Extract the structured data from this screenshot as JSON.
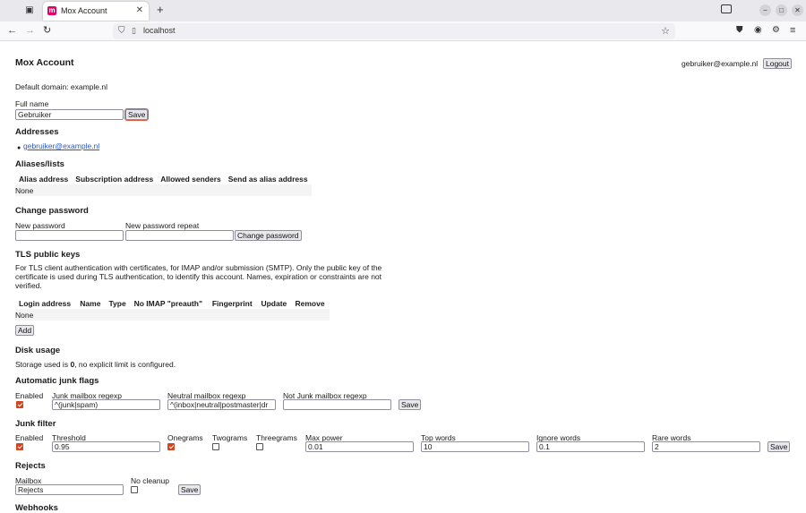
{
  "browser": {
    "tab_title": "Mox Account",
    "favicon_letter": "m",
    "url": "localhost"
  },
  "header": {
    "title": "Mox Account",
    "user_email": "gebruiker@example.nl",
    "logout_label": "Logout"
  },
  "default_domain": "Default domain: example.nl",
  "full_name": {
    "label": "Full name",
    "value": "Gebruiker",
    "save_label": "Save"
  },
  "addresses": {
    "heading": "Addresses",
    "items": [
      "gebruiker@example.nl"
    ]
  },
  "aliases": {
    "heading": "Aliases/lists",
    "columns": [
      "Alias address",
      "Subscription address",
      "Allowed senders",
      "Send as alias address"
    ],
    "empty": "None"
  },
  "change_password": {
    "heading": "Change password",
    "new_label": "New password",
    "repeat_label": "New password repeat",
    "button_label": "Change password"
  },
  "tls": {
    "heading": "TLS public keys",
    "description": "For TLS client authentication with certificates, for IMAP and/or submission (SMTP). Only the public key of the certificate is used during TLS authentication, to identify this account. Names, expiration or constraints are not verified.",
    "columns": [
      "Login address",
      "Name",
      "Type",
      "No IMAP \"preauth\"",
      "Fingerprint",
      "Update",
      "Remove"
    ],
    "empty": "None",
    "add_label": "Add"
  },
  "disk": {
    "heading": "Disk usage",
    "prefix": "Storage used is ",
    "value": "0",
    "suffix": ", no explicit limit is configured."
  },
  "junk_flags": {
    "heading": "Automatic junk flags",
    "enabled_label": "Enabled",
    "enabled": true,
    "junk_label": "Junk mailbox regexp",
    "junk_value": "^(junk|spam)",
    "neutral_label": "Neutral mailbox regexp",
    "neutral_value": "^(inbox|neutral|postmaster|dr",
    "notjunk_label": "Not Junk mailbox regexp",
    "notjunk_value": "",
    "save_label": "Save"
  },
  "junk_filter": {
    "heading": "Junk filter",
    "enabled_label": "Enabled",
    "enabled": true,
    "threshold_label": "Threshold",
    "threshold_value": "0.95",
    "onegrams_label": "Onegrams",
    "onegrams": true,
    "twograms_label": "Twograms",
    "twograms": false,
    "threegrams_label": "Threegrams",
    "threegrams": false,
    "maxpower_label": "Max power",
    "maxpower_value": "0.01",
    "topwords_label": "Top words",
    "topwords_value": "10",
    "ignorewords_label": "Ignore words",
    "ignorewords_value": "0.1",
    "rarewords_label": "Rare words",
    "rarewords_value": "2",
    "save_label": "Save"
  },
  "rejects": {
    "heading": "Rejects",
    "mailbox_label": "Mailbox",
    "mailbox_value": "Rejects",
    "nocleanup_label": "No cleanup",
    "nocleanup": false,
    "save_label": "Save"
  },
  "webhooks": {
    "heading": "Webhooks"
  },
  "colors": {
    "link": "#2a57c9",
    "checkbox_checked": "#d5441c",
    "focus_ring": "#e0563f",
    "favicon": "#e2006b"
  }
}
